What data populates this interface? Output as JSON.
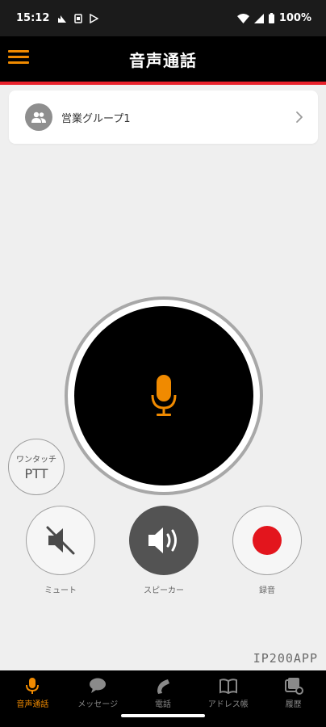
{
  "status_bar": {
    "time": "15:12",
    "battery": "100%"
  },
  "header": {
    "title": "音声通話"
  },
  "group": {
    "name": "営業グループ1"
  },
  "one_touch": {
    "top": "ワンタッチ",
    "bottom": "PTT"
  },
  "controls": {
    "mute_label": "ミュート",
    "speaker_label": "スピーカー",
    "record_label": "録音"
  },
  "brand": "IP200APP",
  "nav": {
    "items": [
      {
        "label": "音声通話",
        "icon": "mic-icon",
        "active": true
      },
      {
        "label": "メッセージ",
        "icon": "chat-icon",
        "active": false
      },
      {
        "label": "電話",
        "icon": "phone-icon",
        "active": false
      },
      {
        "label": "アドレス帳",
        "icon": "book-icon",
        "active": false
      },
      {
        "label": "履歴",
        "icon": "history-icon",
        "active": false
      }
    ]
  },
  "colors": {
    "accent": "#f08a00",
    "header_line": "#e8212b",
    "record": "#e3151d"
  }
}
